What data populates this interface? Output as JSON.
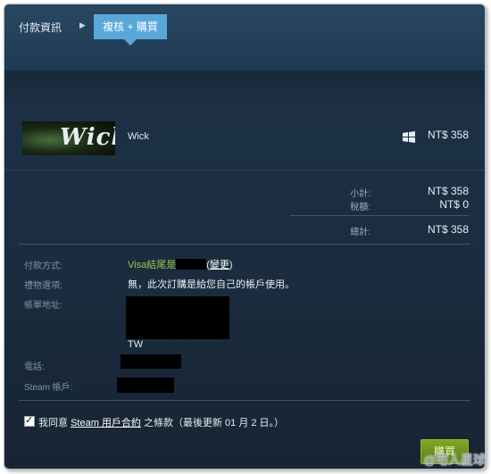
{
  "steps": {
    "step1": "付款資訊",
    "step2": "複核 + 購買"
  },
  "item": {
    "thumb_text": "Wick",
    "name": "Wick",
    "price": "NT$ 358",
    "platform_icon": "windows-icon"
  },
  "summary": {
    "subtotal_label": "小計:",
    "subtotal": "NT$ 358",
    "tax_label": "稅額:",
    "tax": "NT$ 0",
    "total_label": "總計:",
    "total": "NT$ 358"
  },
  "info": {
    "payment_label": "付款方式:",
    "payment_value": "Visa結尾是",
    "change_label": "變更",
    "gift_label": "禮物選項:",
    "gift_value": "無，此次訂購是給您自己的帳戶使用。",
    "billing_label": "帳單地址:",
    "country": "TW",
    "phone_label": "電話:",
    "account_label": "Steam 帳戶:"
  },
  "agree": {
    "prefix": "我同意 ",
    "link": "Steam 用戶合約",
    "suffix": " 之條款（最後更新 01 月 2 日。）"
  },
  "buy_label": "購買",
  "watermark": "@宅人星球",
  "colors": {
    "accent": "#5aa7db",
    "buy": "#6f941f",
    "payment_green": "#9ac44a"
  }
}
